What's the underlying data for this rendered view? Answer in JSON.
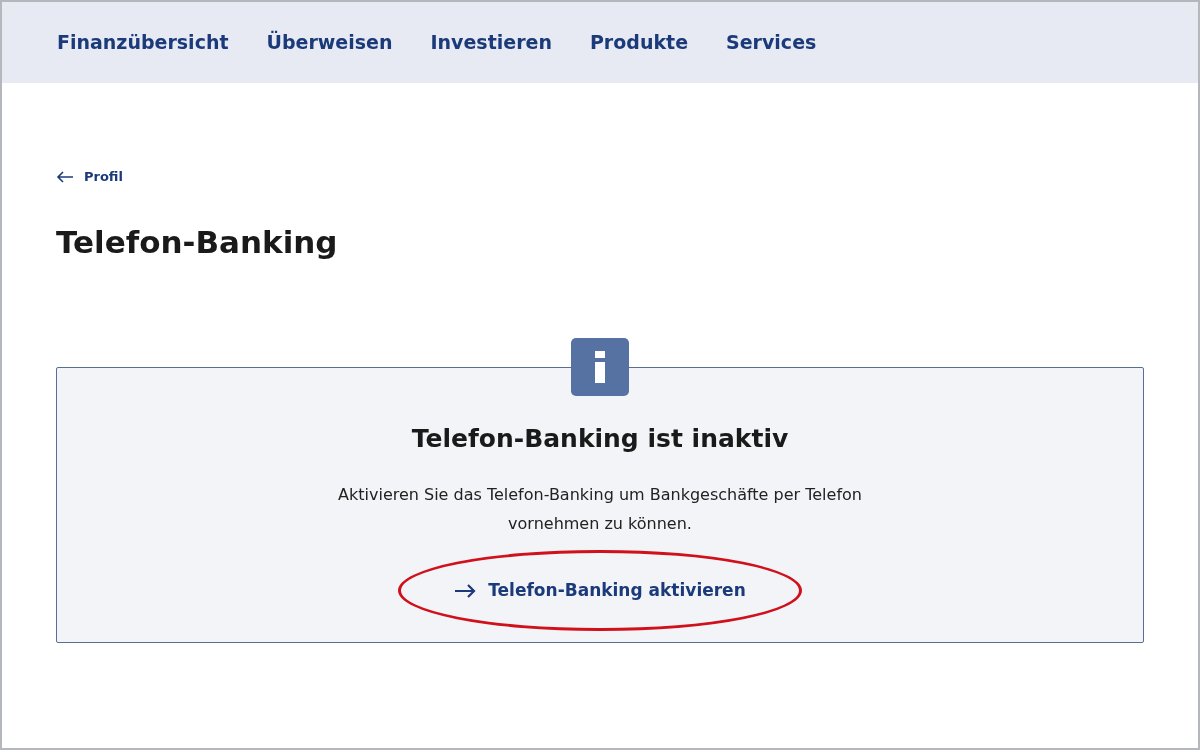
{
  "nav": [
    "Finanzübersicht",
    "Überweisen",
    "Investieren",
    "Produkte",
    "Services"
  ],
  "back_link": "Profil",
  "title": "Telefon-Banking",
  "info_box": {
    "heading": "Telefon-Banking ist inaktiv",
    "text": "Aktivieren Sie das Telefon-Banking um Bankgeschäfte per Telefon vornehmen zu können.",
    "action": {
      "label": "Telefon-Banking aktivieren",
      "circled": true
    }
  }
}
